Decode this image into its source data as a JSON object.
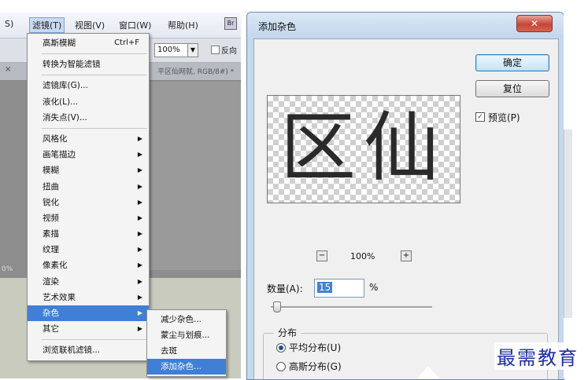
{
  "ps": {
    "menubar": {
      "items": [
        "S)",
        "滤镜(T)",
        "视图(V)",
        "窗口(W)",
        "帮助(H)"
      ]
    },
    "options": {
      "zoom": "100%",
      "zoom_arrow": "▼",
      "flip_label": "反向"
    },
    "doc_tab": {
      "title": "平区仙网就, RGB/8#) *",
      "close": "×"
    },
    "zoom_left": "0%",
    "filter_menu": {
      "last_filter": "高斯模糊",
      "last_filter_shortcut": "Ctrl+F",
      "convert_smart": "转换为智能滤镜",
      "gallery": "滤镜库(G)...",
      "liquify": "液化(L)...",
      "vanishing": "消失点(V)...",
      "items": [
        {
          "label": "风格化"
        },
        {
          "label": "画笔描边"
        },
        {
          "label": "模糊"
        },
        {
          "label": "扭曲"
        },
        {
          "label": "锐化"
        },
        {
          "label": "视频"
        },
        {
          "label": "素描"
        },
        {
          "label": "纹理"
        },
        {
          "label": "像素化"
        },
        {
          "label": "渲染"
        },
        {
          "label": "艺术效果"
        },
        {
          "label": "杂色"
        },
        {
          "label": "其它"
        }
      ],
      "browse_online": "浏览联机滤镜..."
    },
    "noise_submenu": {
      "items": [
        "减少杂色...",
        "蒙尘与划痕...",
        "去斑",
        "添加杂色..."
      ]
    },
    "arrow_glyph": "▶"
  },
  "dialog": {
    "title": "添加杂色",
    "close": "✕",
    "ok": "确定",
    "reset": "复位",
    "preview_label": "预览(P)",
    "preview_checked": "✓",
    "preview_text": "区仙",
    "zoom_minus": "−",
    "zoom_plus": "+",
    "zoom": "100%",
    "amount_label": "数量(A):",
    "amount_value": "15",
    "amount_unit": "%",
    "distribution_label": "分布",
    "uniform": "平均分布(U)",
    "gaussian": "高斯分布(G)"
  },
  "watermark": "最需教育",
  "colors": {
    "accent": "#3f7fd6",
    "close": "#c4463a",
    "watermark": "#1f2f9b"
  }
}
